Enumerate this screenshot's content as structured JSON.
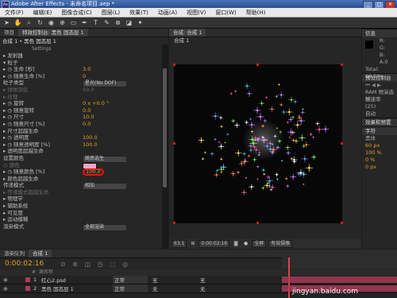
{
  "window": {
    "title": "Adobe After Effects - 未命名项目.aep *",
    "controls": [
      "_",
      "□",
      "✕"
    ]
  },
  "menu": [
    "文件(F)",
    "编辑(E)",
    "图像合成(C)",
    "图层(L)",
    "效果(T)",
    "动画(A)",
    "视图(V)",
    "窗口(W)",
    "帮助(H)"
  ],
  "left_panel": {
    "tabs": [
      "项目",
      "特效控制台: 黑色 固态层 1"
    ],
    "header": "合成 1 • 黑色 固态层 1",
    "settings_label": "Settings",
    "rows": [
      {
        "text": "▸ 发射器"
      },
      {
        "text": "▾ 粒子"
      },
      {
        "text": "  ▸ ◷ 生命 [秒]",
        "value": "3.0"
      },
      {
        "text": "  ▸ ◷ 随意生命 [%]",
        "value": "0"
      },
      {
        "text": "    粒子类型",
        "dropdown": "星光(No DOF)"
      },
      {
        "text": "  ▸ 球体羽化",
        "value": "50.0",
        "dim": true
      },
      {
        "text": "  ▸ 纹理",
        "dim": true
      },
      {
        "text": "  ▸ ◷ 旋转",
        "value": "0 x +0.0 °"
      },
      {
        "text": "  ▸ ◷ 随意旋转",
        "value": "0.0"
      },
      {
        "text": "  ▸ ◷ 尺寸",
        "value": "10.0"
      },
      {
        "text": "  ▸ ◷ 随意尺寸 [%]",
        "value": "0.0"
      },
      {
        "text": "  ▸ 尺寸超越生命"
      },
      {
        "text": "  ▸ ◷ 透明度",
        "value": "100.0"
      },
      {
        "text": "  ▸ ◷ 随意透明度 [%]",
        "value": "100.0"
      },
      {
        "text": "  ▸ 透明度超越生命"
      },
      {
        "text": "    设置颜色",
        "dropdown": "随意选生"
      },
      {
        "text": "    ◷ 颜色",
        "swatch": "#e8a8c8",
        "dim": true
      },
      {
        "text": "  ▸ ◷ 随意颜色 [%]",
        "value": "100.0",
        "circled": true
      },
      {
        "text": "  ▸ 颜色超越生命"
      },
      {
        "text": "    传递模式",
        "dropdown": "相加"
      },
      {
        "text": "  ▸ 传递模式超越生命",
        "dim": true
      },
      {
        "text": "▸ 物理学"
      },
      {
        "text": "▸ 辅助系统"
      },
      {
        "text": "▸ 可见度"
      },
      {
        "text": "▸ 运动模糊"
      },
      {
        "text": "    渲染模式",
        "dropdown": "全部渲染"
      }
    ]
  },
  "composition": {
    "tab": "合成: 合成 1",
    "subtab": "合成 1",
    "bottom": {
      "zoom": "63.1",
      "timecode": "0:00:02:16",
      "view": "全屏",
      "camera": "有效摄像"
    }
  },
  "right_panel": {
    "info_title": "信息",
    "info_values": [
      "R:",
      "G:",
      "B:",
      "A:0"
    ],
    "total": "Total: 69.1%",
    "preview_title": "预览控制台",
    "ram_label": "RAM 预演选项",
    "framerate_label": "帧速率",
    "framerate_value": "(25)",
    "resolution_value": "自动",
    "effects_title": "效果和预置",
    "char_title": "字符",
    "char_font": "黑体",
    "font_size": "60 px",
    "scale_v": "100 %",
    "scale_h": "0 %",
    "tracking": "0 px"
  },
  "timeline": {
    "tabs": [
      "渲染队列",
      "合成 1"
    ],
    "timecode": "0:00:02:16",
    "layers": [
      {
        "index": "1",
        "name": "红心2.psd",
        "mode": "正常",
        "color": "#b03a5a"
      },
      {
        "index": "2",
        "name": "黑色 固态层 1",
        "mode": "正常",
        "color": "#b03a5a"
      }
    ],
    "track_label": "无",
    "parent_label": "无",
    "watermark": "jingyan.baidu.com"
  }
}
